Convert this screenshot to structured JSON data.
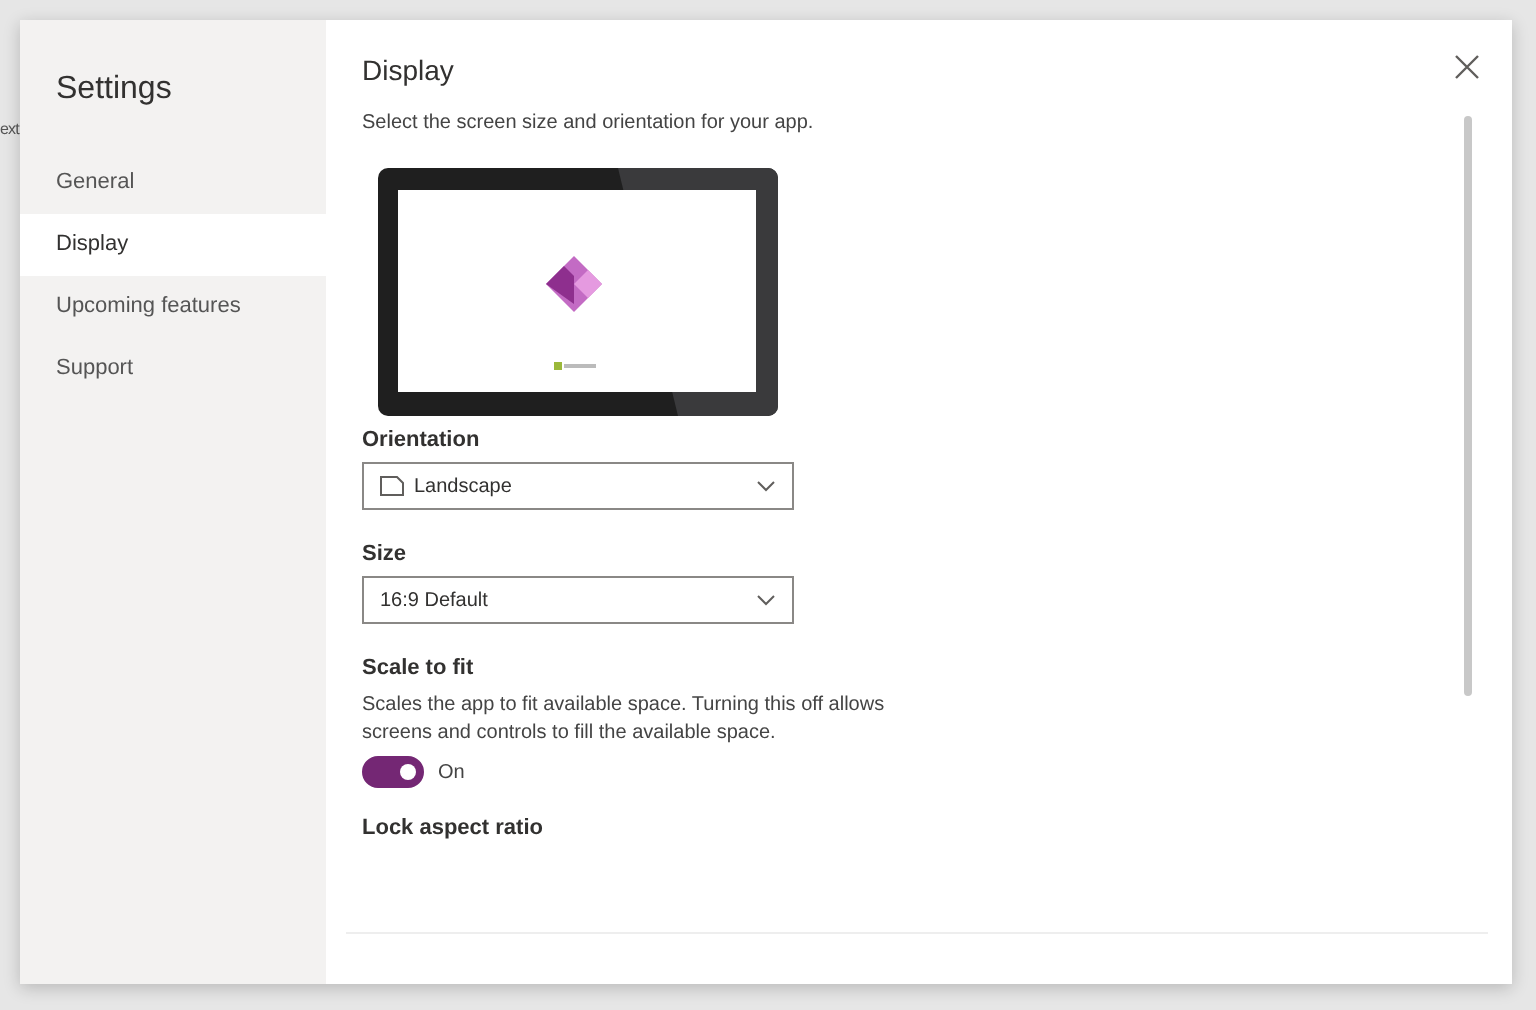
{
  "background_text": "ext",
  "sidebar": {
    "title": "Settings",
    "items": [
      {
        "label": "General",
        "selected": false
      },
      {
        "label": "Display",
        "selected": true
      },
      {
        "label": "Upcoming features",
        "selected": false
      },
      {
        "label": "Support",
        "selected": false
      }
    ]
  },
  "content": {
    "title": "Display",
    "description": "Select the screen size and orientation for your app.",
    "orientation": {
      "label": "Orientation",
      "value": "Landscape"
    },
    "size": {
      "label": "Size",
      "value": "16:9 Default"
    },
    "scale_to_fit": {
      "label": "Scale to fit",
      "description": "Scales the app to fit available space. Turning this off allows screens and controls to fill the available space.",
      "on": true,
      "state_text": "On"
    },
    "lock_aspect_ratio": {
      "label": "Lock aspect ratio"
    }
  }
}
